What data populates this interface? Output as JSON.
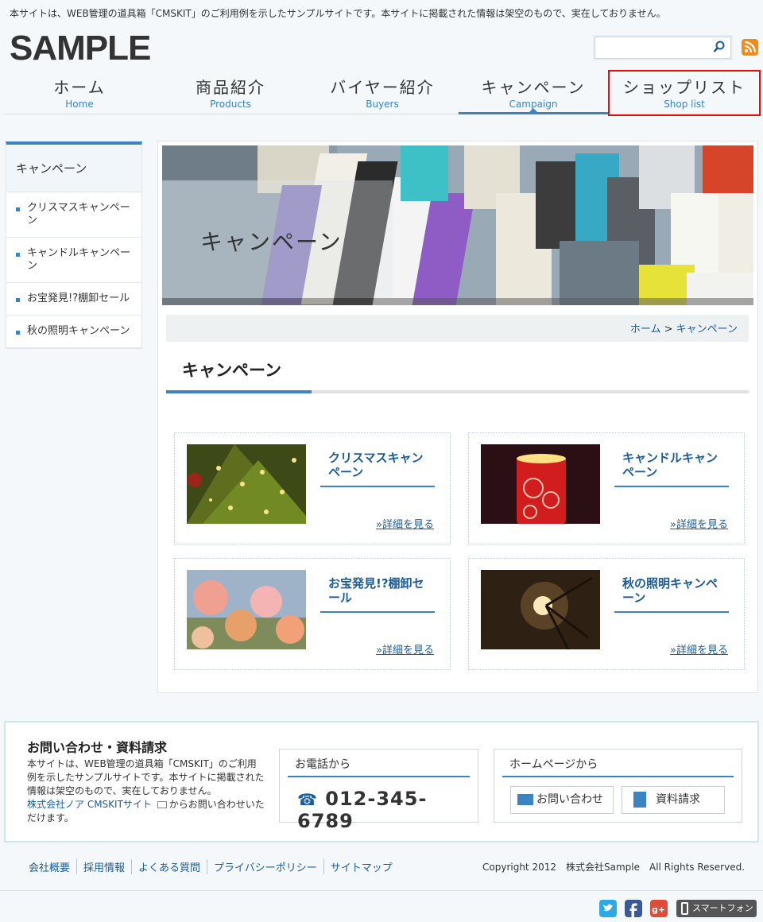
{
  "header": {
    "notice": "本サイトは、WEB管理の道具箱「CMSKIT」のご利用例を示したサンプルサイトです。本サイトに掲載された情報は架空のもので、実在しておりません。",
    "logo": "SAMPLE",
    "search_value": ""
  },
  "nav": [
    {
      "jp": "ホーム",
      "en": "Home"
    },
    {
      "jp": "商品紹介",
      "en": "Products"
    },
    {
      "jp": "バイヤー紹介",
      "en": "Buyers"
    },
    {
      "jp": "キャンペーン",
      "en": "Campaign"
    },
    {
      "jp": "ショップリスト",
      "en": "Shop list"
    }
  ],
  "sidebar": {
    "title": "キャンペーン",
    "items": [
      "クリスマスキャンペーン",
      "キャンドルキャンペーン",
      "お宝発見!?棚卸セール",
      "秋の照明キャンペーン"
    ]
  },
  "hero": {
    "title": "キャンペーン"
  },
  "breadcrumb": {
    "home": "ホーム",
    "separator": ">",
    "current": "キャンペーン"
  },
  "page_title": "キャンペーン",
  "cards": [
    {
      "title": "クリスマスキャンペーン",
      "more": "»詳細を見る"
    },
    {
      "title": "キャンドルキャンペーン",
      "more": "»詳細を見る"
    },
    {
      "title": "お宝発見!?棚卸セール",
      "more": "»詳細を見る"
    },
    {
      "title": "秋の照明キャンペーン",
      "more": "»詳細を見る"
    }
  ],
  "contact": {
    "title": "お問い合わせ・資料請求",
    "desc_text": "本サイトは、WEB管理の道具箱「CMSKIT」のご利用例を示したサンプルサイトです。本サイトに掲載された情報は架空のもので、実在しておりません。",
    "desc_link": "株式会社ノア CMSKITサイト",
    "desc_tail": "からお問い合わせいただけます。",
    "phone_title": "お電話から",
    "phone_number": "012-345-6789",
    "hp_title": "ホームページから",
    "inquiry_button": "お問い合わせ",
    "document_button": "資料請求"
  },
  "footer": {
    "links": [
      "会社概要",
      "採用情報",
      "よくある質問",
      "プライバシーポリシー",
      "サイトマップ"
    ],
    "copyright": "Copyright 2012　株式会社Sample　All Rights Reserved.",
    "smartphone": "スマートフォン"
  },
  "colors": {
    "accent": "#3a84c4",
    "link": "#1a5c9a",
    "rss": "#f38b1a",
    "highlight": "#e01010"
  }
}
